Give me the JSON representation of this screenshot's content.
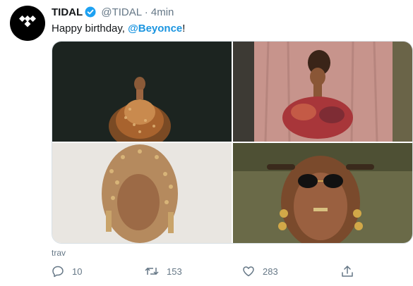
{
  "tweet": {
    "author_name": "TIDAL",
    "handle": "@TIDAL",
    "separator": "·",
    "time": "4min",
    "text_before": "Happy birthday, ",
    "mention": "@Beyonce",
    "text_after": "!",
    "media_caption": "trav"
  },
  "actions": {
    "reply_count": "10",
    "retweet_count": "153",
    "like_count": "283"
  },
  "colors": {
    "mention": "#1b95e0",
    "verified": "#1da1f2",
    "muted_text": "#657786"
  },
  "icons": [
    "tidal-logo-icon",
    "verified-badge-icon",
    "reply-icon",
    "retweet-icon",
    "like-icon",
    "share-icon"
  ]
}
